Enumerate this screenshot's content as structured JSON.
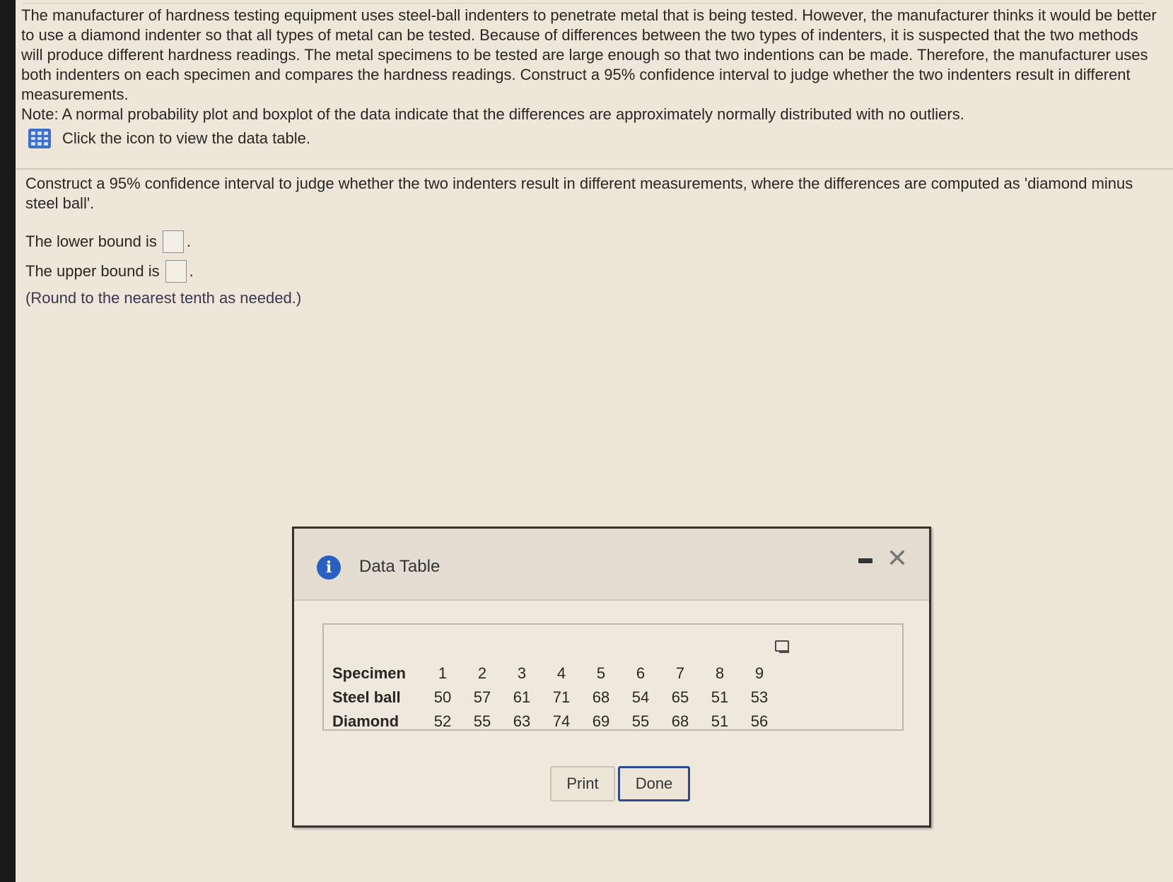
{
  "question": {
    "paragraph": "The manufacturer of hardness testing equipment uses steel-ball indenters to penetrate metal that is being tested. However, the manufacturer thinks it would be better to use a diamond indenter so that all types of metal can be tested. Because of differences between the two types of indenters, it is suspected that the two methods will produce different hardness readings. The metal specimens to be tested are large enough so that two indentions can be made. Therefore, the manufacturer uses both indenters on each specimen and compares the hardness readings. Construct a 95% confidence interval to judge whether the two indenters result in different measurements.",
    "note": "Note: A normal probability plot and boxplot of the data indicate that the differences are approximately normally distributed with no outliers.",
    "table_link_label": "Click the icon to view the data table.",
    "table_icon": "grid-icon"
  },
  "part": {
    "prompt": "Construct a 95% confidence interval to judge whether the two indenters result in different measurements, where the differences are computed as 'diamond minus steel ball'.",
    "lower_label": "The lower bound is",
    "lower_value": "",
    "upper_label": "The upper bound is",
    "upper_value": "",
    "suffix": ".",
    "round_note": "(Round to the nearest tenth as needed.)"
  },
  "modal": {
    "title": "Data Table",
    "info_icon": "i",
    "close_glyph": "✕",
    "table": {
      "rows": [
        {
          "label": "Specimen",
          "values": [
            "1",
            "2",
            "3",
            "4",
            "5",
            "6",
            "7",
            "8",
            "9"
          ]
        },
        {
          "label": "Steel ball",
          "values": [
            "50",
            "57",
            "61",
            "71",
            "68",
            "54",
            "65",
            "51",
            "53"
          ]
        },
        {
          "label": "Diamond",
          "values": [
            "52",
            "55",
            "63",
            "74",
            "69",
            "55",
            "68",
            "51",
            "56"
          ]
        }
      ]
    },
    "print_label": "Print",
    "done_label": "Done"
  }
}
